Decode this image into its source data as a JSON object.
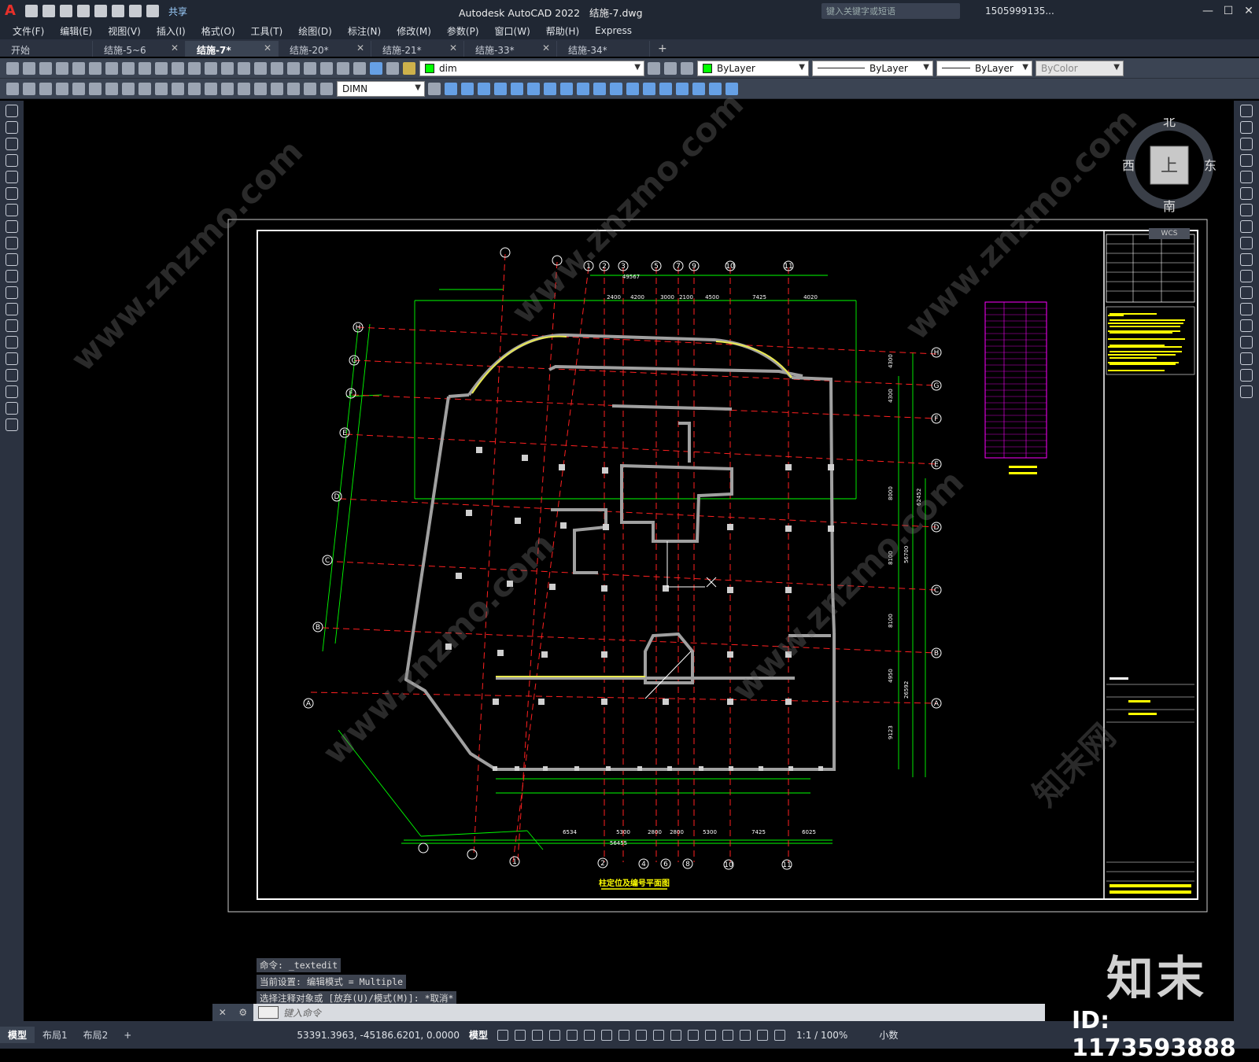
{
  "app": {
    "logo": "A",
    "title": "Autodesk AutoCAD 2022",
    "filename": "结施-7.dwg",
    "share": "共享",
    "search_placeholder": "键入关键字或短语",
    "user": "1505999135...",
    "window_buttons": [
      "—",
      "☐",
      "✕"
    ]
  },
  "menu": [
    "文件(F)",
    "编辑(E)",
    "视图(V)",
    "插入(I)",
    "格式(O)",
    "工具(T)",
    "绘图(D)",
    "标注(N)",
    "修改(M)",
    "参数(P)",
    "窗口(W)",
    "帮助(H)",
    "Express"
  ],
  "tabs": [
    {
      "label": "开始",
      "active": false,
      "closable": false
    },
    {
      "label": "结施-5~6",
      "active": false,
      "closable": true
    },
    {
      "label": "结施-7*",
      "active": true,
      "closable": true
    },
    {
      "label": "结施-20*",
      "active": false,
      "closable": true
    },
    {
      "label": "结施-21*",
      "active": false,
      "closable": true
    },
    {
      "label": "结施-33*",
      "active": false,
      "closable": true
    },
    {
      "label": "结施-34*",
      "active": false,
      "closable": true
    }
  ],
  "toolbar1": {
    "layer": "dim",
    "color": "ByLayer",
    "linetype": "ByLayer",
    "lineweight": "ByLayer",
    "plotstyle": "ByColor",
    "layer_color": "#00ff00"
  },
  "toolbar2": {
    "dimstyle": "DIMN"
  },
  "viewcube": {
    "north": "北",
    "south": "南",
    "east": "东",
    "west": "西",
    "top": "上",
    "wcs": "WCS"
  },
  "drawing": {
    "title": "柱定位及编号平面图",
    "grid_top": [
      "1",
      "2",
      "3",
      "5",
      "7",
      "9",
      "10",
      "11"
    ],
    "grid_bottom": [
      "1",
      "2",
      "4",
      "6",
      "8",
      "10",
      "11"
    ],
    "grid_left": [
      "H",
      "G",
      "F",
      "E",
      "D",
      "C",
      "B",
      "A"
    ],
    "grid_right": [
      "H",
      "G",
      "F",
      "E",
      "D",
      "C",
      "B",
      "A"
    ],
    "dims_top": [
      "2400",
      "4200",
      "3000",
      "2100",
      "4500",
      "7425",
      "4020"
    ],
    "dims_total_top": "49567",
    "dims_bottom": [
      "6534",
      "5300",
      "2800",
      "2800",
      "5300",
      "7425",
      "6025"
    ],
    "dims_total_bottom": "56455",
    "dims_right": [
      "4300",
      "4300",
      "8000",
      "8100",
      "8100",
      "4950",
      "9123"
    ],
    "dims_right_total": [
      "56700",
      "26592",
      "62452"
    ]
  },
  "command": {
    "lines": [
      "命令: _textedit",
      "当前设置: 编辑模式 = Multiple",
      "选择注释对象或 [放弃(U)/模式(M)]: *取消*"
    ],
    "placeholder": "键入命令"
  },
  "status": {
    "tabs": [
      "模型",
      "布局1",
      "布局2"
    ],
    "coords": "53391.3963, -45186.6201, 0.0000",
    "mode": "模型",
    "scale": "1:1 / 100%",
    "units": "小数"
  },
  "watermark": {
    "logo": "知末",
    "id": "ID: 1173593888",
    "text": "www.znzmo.com",
    "text2": "知末网"
  }
}
